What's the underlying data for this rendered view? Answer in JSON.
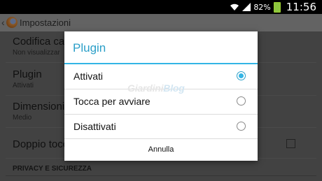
{
  "status_bar": {
    "battery_percent": "82%",
    "time": "11:56",
    "icons": [
      "wifi-icon",
      "signal-icon",
      "battery-icon"
    ]
  },
  "action_bar": {
    "title": "Impostazioni",
    "icons": [
      "back-icon",
      "firefox-logo-icon"
    ]
  },
  "settings": {
    "items": [
      {
        "title": "Codifica cara",
        "summary": "Non visualizzar"
      },
      {
        "title": "Plugin",
        "summary": "Attivati"
      },
      {
        "title": "Dimensioni te",
        "summary": "Medio"
      },
      {
        "title": "Doppio tocco",
        "checked": false
      }
    ],
    "section_header": "PRIVACY E SICUREZZA"
  },
  "dialog": {
    "title": "Plugin",
    "options": [
      {
        "label": "Attivati",
        "selected": true
      },
      {
        "label": "Tocca per avviare",
        "selected": false
      },
      {
        "label": "Disattivati",
        "selected": false
      }
    ],
    "cancel_label": "Annulla",
    "watermark": {
      "part1": "Giardini",
      "part2": "Blog"
    }
  },
  "colors": {
    "accent": "#33b5e5",
    "title_text": "#2b9fc8",
    "status_bar": "#000000",
    "battery": "#8dc63f"
  }
}
